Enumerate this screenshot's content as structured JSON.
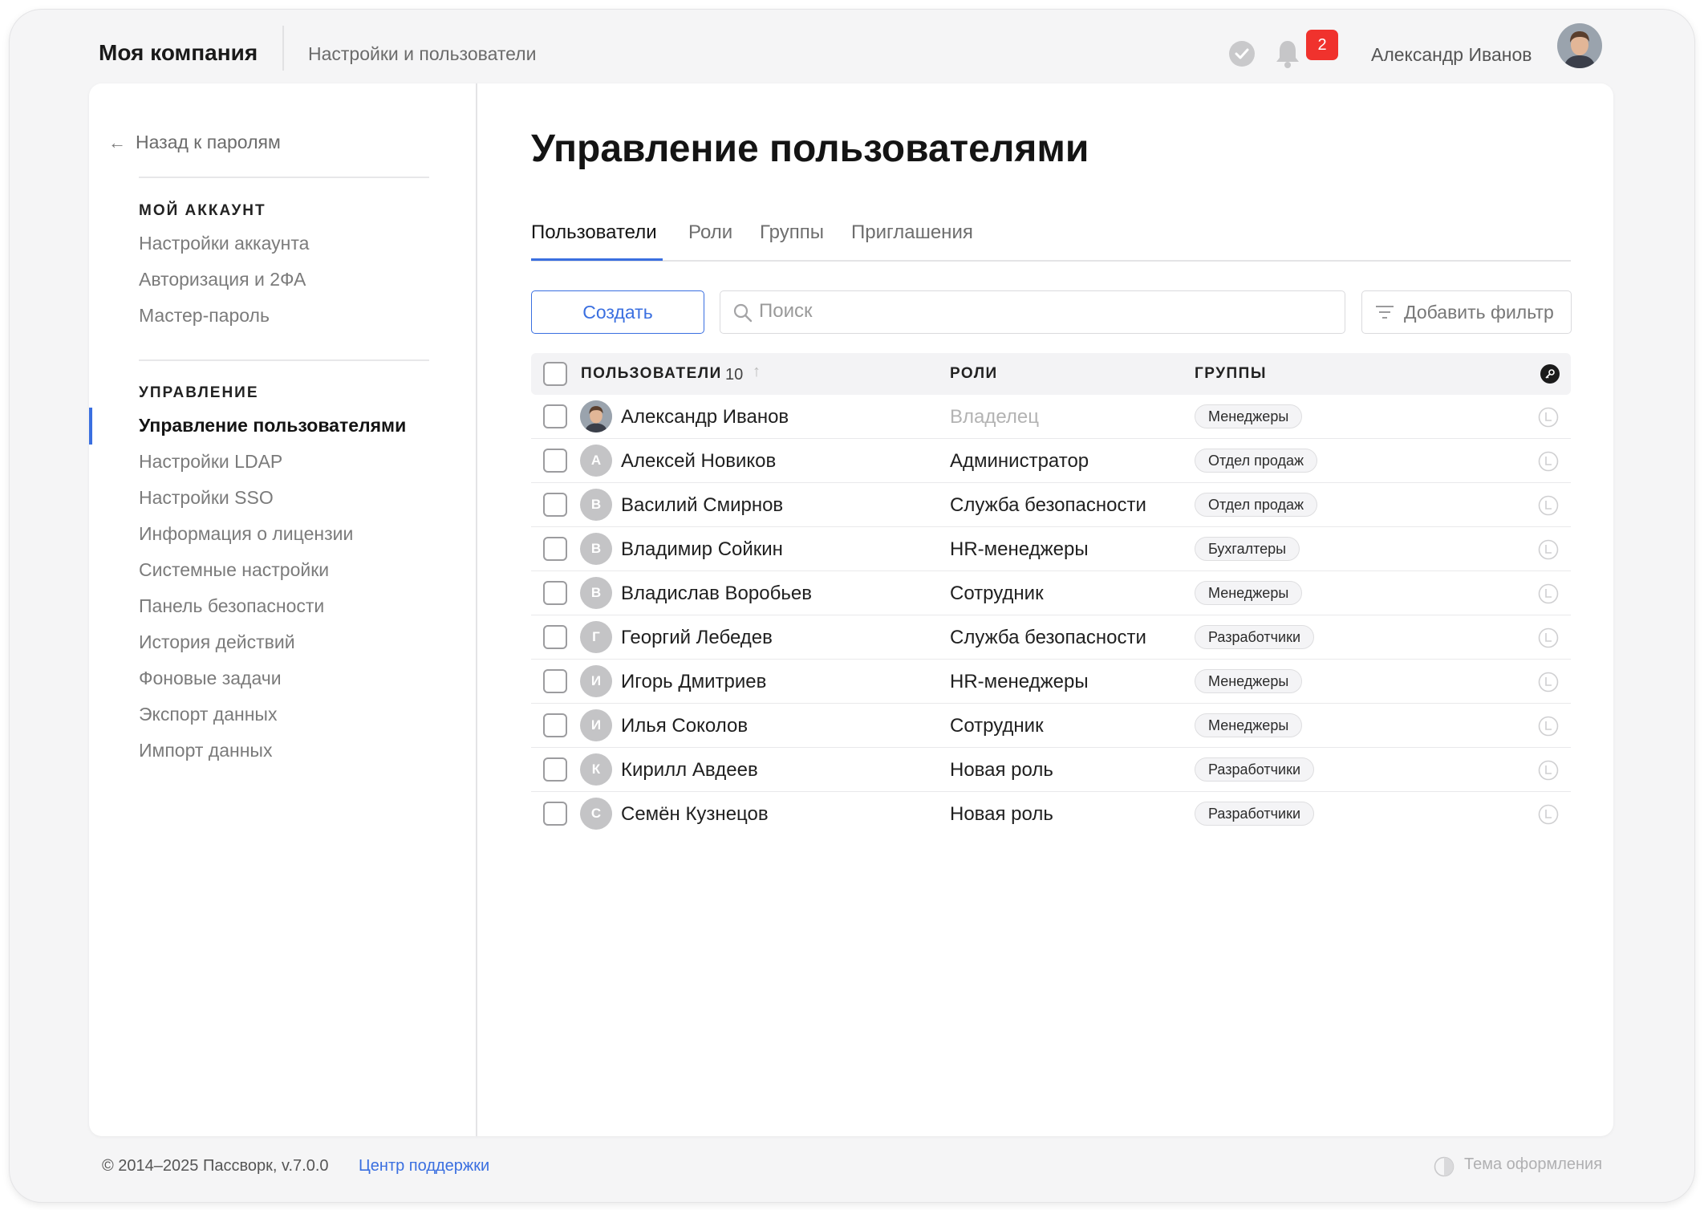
{
  "header": {
    "company": "Моя компания",
    "breadcrumb": "Настройки и пользователи",
    "notifications_count": "2",
    "user_name": "Александр Иванов"
  },
  "sidebar": {
    "back_label": "Назад к паролям",
    "section1_title": "МОЙ АККАУНТ",
    "section1_items": [
      "Настройки аккаунта",
      "Авторизация и 2ФА",
      "Мастер-пароль"
    ],
    "section2_title": "УПРАВЛЕНИЕ",
    "section2_items": [
      "Управление пользователями",
      "Настройки LDAP",
      "Настройки SSO",
      "Информация о лицензии",
      "Системные настройки",
      "Панель безопасности",
      "История действий",
      "Фоновые задачи",
      "Экспорт данных",
      "Импорт данных"
    ]
  },
  "main": {
    "title": "Управление пользователями",
    "tabs": [
      "Пользователи",
      "Роли",
      "Группы",
      "Приглашения"
    ],
    "create_label": "Создать",
    "search_placeholder": "Поиск",
    "filter_label": "Добавить фильтр"
  },
  "table": {
    "col_users": "ПОЛЬЗОВАТЕЛИ",
    "users_count": "10",
    "col_roles": "РОЛИ",
    "col_groups": "ГРУППЫ",
    "rows": [
      {
        "initial": "",
        "name": "Александр Иванов",
        "role": "Владелец",
        "group": "Менеджеры"
      },
      {
        "initial": "А",
        "name": "Алексей Новиков",
        "role": "Администратор",
        "group": "Отдел продаж"
      },
      {
        "initial": "В",
        "name": "Василий Смирнов",
        "role": "Служба безопасности",
        "group": "Отдел продаж"
      },
      {
        "initial": "В",
        "name": "Владимир Сойкин",
        "role": "HR-менеджеры",
        "group": "Бухгалтеры"
      },
      {
        "initial": "В",
        "name": "Владислав Воробьев",
        "role": "Сотрудник",
        "group": "Менеджеры"
      },
      {
        "initial": "Г",
        "name": "Георгий Лебедев",
        "role": "Служба безопасности",
        "group": "Разработчики"
      },
      {
        "initial": "И",
        "name": "Игорь Дмитриев",
        "role": "HR-менеджеры",
        "group": "Менеджеры"
      },
      {
        "initial": "И",
        "name": "Илья Соколов",
        "role": "Сотрудник",
        "group": "Менеджеры"
      },
      {
        "initial": "К",
        "name": "Кирилл Авдеев",
        "role": "Новая роль",
        "group": "Разработчики"
      },
      {
        "initial": "С",
        "name": "Семён Кузнецов",
        "role": "Новая роль",
        "group": "Разработчики"
      }
    ]
  },
  "footer": {
    "copyright": "© 2014–2025 Пассворк, v.7.0.0",
    "support_link": "Центр поддержки",
    "theme_label": "Тема оформления"
  },
  "colors": {
    "accent": "#3a6fe0",
    "badge": "#f0322d"
  }
}
